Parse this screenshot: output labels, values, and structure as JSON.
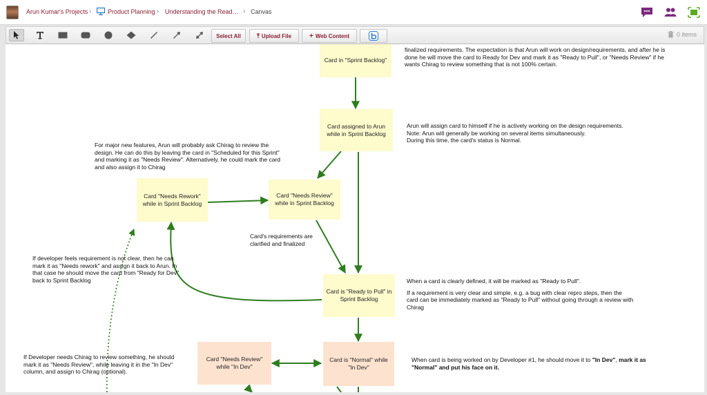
{
  "breadcrumb": {
    "project": "Arun Kumar's Projects",
    "board": "Product Planning",
    "page": "Understanding the Read…",
    "current": "Canvas"
  },
  "toolbar": {
    "tools": [
      "pointer-tool",
      "text-tool",
      "rectangle-tool",
      "rounded-rectangle-tool",
      "circle-tool",
      "diamond-tool",
      "line-tool",
      "arrow-tool",
      "double-arrow-tool"
    ],
    "select_all": "Select All",
    "upload_file": "Upload File",
    "web_content": "Web Content",
    "trash_count": "0 items"
  },
  "colors": {
    "accent": "#8a2035",
    "card_yellow": "#fefbcc",
    "card_peach": "#fde3cf",
    "arrow": "#2e7d1e",
    "icon_purple": "#7b2a7e",
    "icon_green": "#5aaa22"
  },
  "cards": {
    "sprint_backlog": "Card in \"Sprint Backlog\"",
    "assigned": "Card assigned to Arun while in Sprint Backlog",
    "needs_review": "Card \"Needs Review\" while in Sprint Backlog",
    "needs_rework": "Card \"Needs Rework\" while in Sprint Backlog",
    "ready_to_pull": "Card is \"Ready to Pull\" in Sprint Backlog",
    "needs_review_dev": "Card \"Needs Review\" while \"In Dev\"",
    "normal_dev": "Card is \"Normal\" while \"In Dev\""
  },
  "notes": {
    "top": "finalized requirements. The expectation is that Arun will work on design/requirements, and after he is done he will move the card to Ready for Dev and mark it as \"Ready to Pull\", or \"Needs Review\" if he wants Chirag to review something that is not 100% certain.",
    "assign_1": "Arun will assign card to himself if he is actively working on the design requirements.",
    "assign_2": "Note: Arun will generally be working on several items simultaneously.",
    "assign_3": "During this time, the card's status is Normal.",
    "major": "For major new features, Arun will probably ask Chirag to review the design. He can do this by leaving the card in \"Scheduled for this Sprint\" and marking it as \"Needs Review\". Alternatively, he could mark the card and also assign it to Chirag",
    "clarified": "Card's requirements are clarified and finalized",
    "developer_unclear": "If developer feels requirement is not clear, then he can mark it as \"Needs rework\" and assign it back to Arun. In that case he should move the card from \"Ready for Dev\" back to Sprint Backlog",
    "ready_1": "When a card is clearly defined, it will be marked as \"Ready to Pull\".",
    "ready_2": "If a requirement is very clear and simple, e.g. a bug with clear repro steps, then the card can be immediately marked as \"Ready to Pull\" without going through a review with Chirag",
    "review_dev": "If Developer needs Chirag to review something, he should mark it as \"Needs Review\", while leaving it in the \"In Dev\" column, and assign to Chirag (optional).",
    "dev_pre": "When card is being worked on by Developer #1, he should move it to ",
    "dev_in_dev": "\"In Dev\"",
    "dev_mid": ", ",
    "dev_bold": "mark it as \"Normal\" and put his face on it."
  }
}
